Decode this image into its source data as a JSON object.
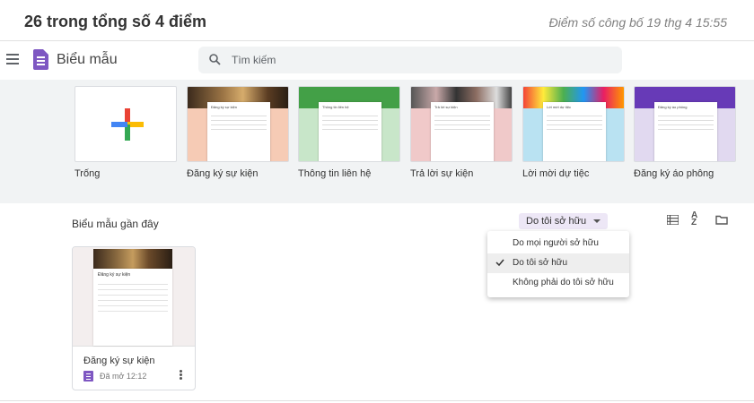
{
  "score": {
    "title": "26 trong tổng số 4 điểm",
    "published": "Điểm số công bố 19 thg 4 15:55"
  },
  "header": {
    "app_name": "Biểu mẫu",
    "search_placeholder": "Tìm kiếm"
  },
  "templates": [
    {
      "label": "Trống",
      "icon": "plus-icon"
    },
    {
      "label": "Đăng ký sự kiện",
      "card_title": "Đăng ký sự kiện",
      "bg": "#f6cbb5"
    },
    {
      "label": "Thông tin liên hệ",
      "card_title": "Thông tin liên hệ",
      "bg": "#c8e6c9"
    },
    {
      "label": "Trả lời sự kiện",
      "card_title": "Trả lời sự kiện",
      "bg": "#f0c9c9"
    },
    {
      "label": "Lời mời dự tiệc",
      "card_title": "Lời mời dự tiệc",
      "bg": "#b9e2f2"
    },
    {
      "label": "Đăng ký áo phông",
      "card_title": "Đăng ký áo phông",
      "bg": "#e1d9f0"
    }
  ],
  "recent": {
    "title": "Biểu mẫu gần đây",
    "owner_filter": "Do tôi sở hữu",
    "menu": [
      {
        "label": "Do mọi người sở hữu",
        "selected": false
      },
      {
        "label": "Do tôi sở hữu",
        "selected": true
      },
      {
        "label": "Không phải do tôi sở hữu",
        "selected": false
      }
    ],
    "forms": [
      {
        "name": "Đăng ký sự kiện",
        "opened": "Đã mở 12:12",
        "card_title": "Đăng ký sự kiện"
      }
    ]
  },
  "colors": {
    "brand": "#7e57c2",
    "filter_bg": "#ede7f6",
    "gallery_bg": "#f1f3f4"
  }
}
